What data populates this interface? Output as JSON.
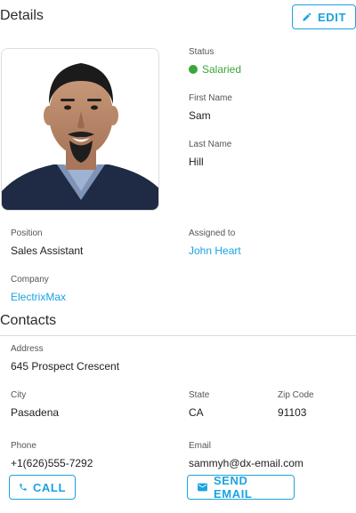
{
  "details": {
    "title": "Details",
    "edit_label": "EDIT",
    "status": {
      "label": "Status",
      "value": "Salaried",
      "color": "#3aa63a"
    },
    "first_name": {
      "label": "First Name",
      "value": "Sam"
    },
    "last_name": {
      "label": "Last Name",
      "value": "Hill"
    },
    "position": {
      "label": "Position",
      "value": "Sales Assistant"
    },
    "assigned_to": {
      "label": "Assigned to",
      "value": "John Heart"
    },
    "company": {
      "label": "Company",
      "value": "ElectrixMax"
    }
  },
  "contacts": {
    "title": "Contacts",
    "address": {
      "label": "Address",
      "value": "645 Prospect Crescent"
    },
    "city": {
      "label": "City",
      "value": "Pasadena"
    },
    "state": {
      "label": "State",
      "value": "CA"
    },
    "zip": {
      "label": "Zip Code",
      "value": "91103"
    },
    "phone": {
      "label": "Phone",
      "value": "+1(626)555-7292"
    },
    "email": {
      "label": "Email",
      "value": "sammyh@dx-email.com"
    },
    "call_label": "CALL",
    "send_email_label": "SEND EMAIL"
  },
  "icons": {
    "edit": "pencil-icon",
    "call": "phone-icon",
    "email": "email-icon"
  },
  "colors": {
    "accent": "#1aa3e0",
    "status_green": "#3aa63a"
  }
}
